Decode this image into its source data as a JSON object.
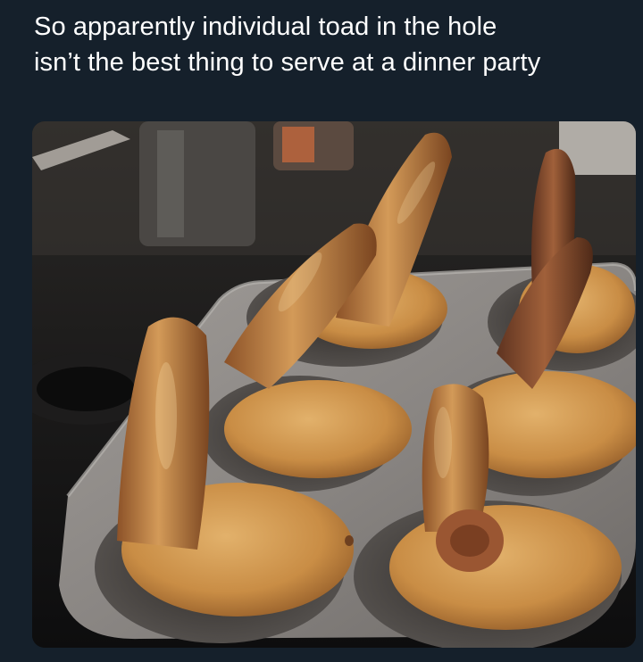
{
  "post": {
    "caption_line1": "So apparently individual toad in the hole",
    "caption_line2": "isn’t the best thing to serve at a dinner party"
  },
  "colors": {
    "background": "#15202b",
    "text": "#ffffff",
    "tray": "#8b8784",
    "pudding": "#c98d45",
    "sausage": "#b06a3a"
  }
}
